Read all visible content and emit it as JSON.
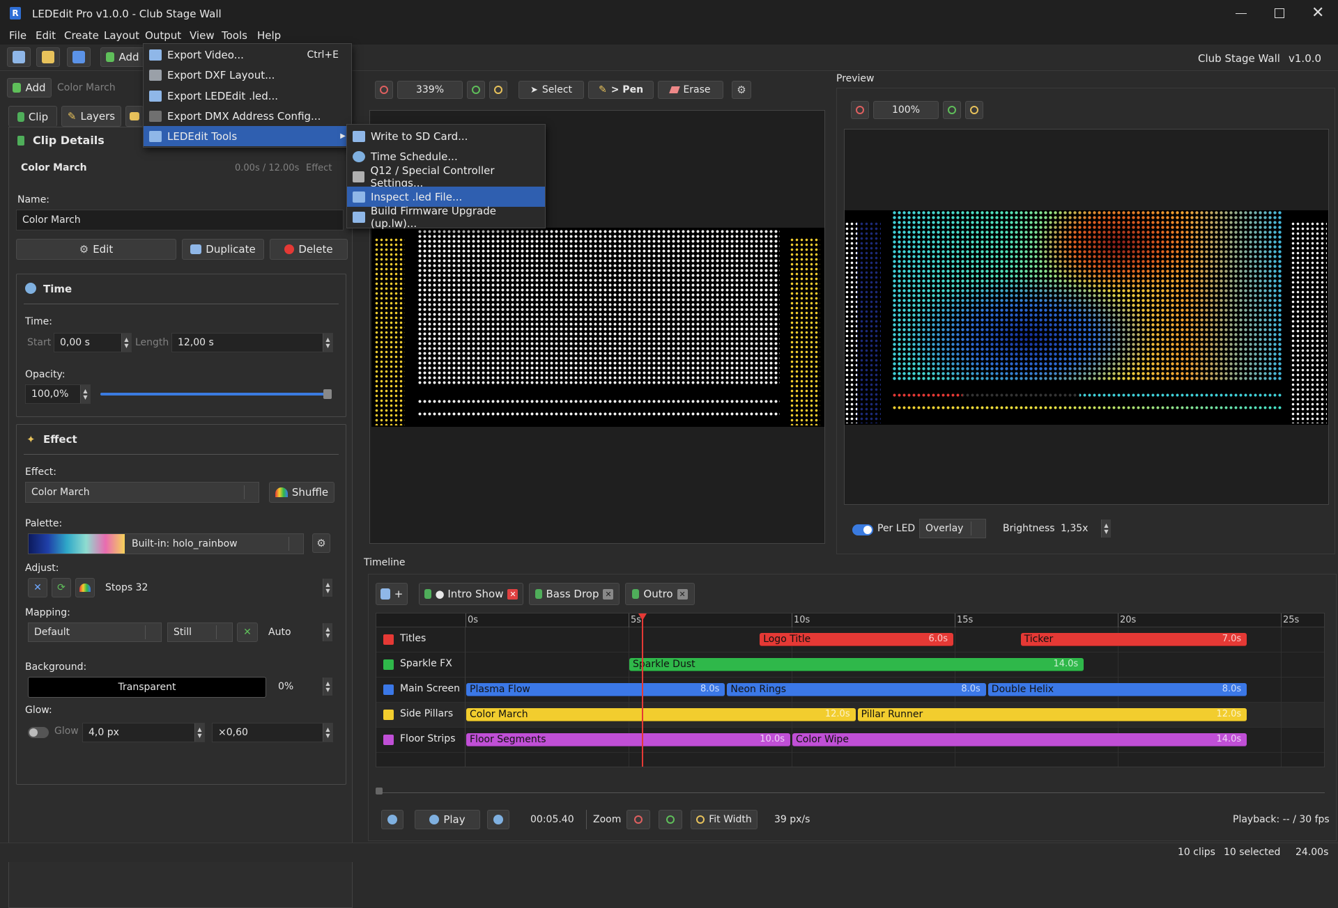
{
  "window": {
    "title": "LEDEdit Pro v1.0.0 - Club Stage Wall",
    "project_name": "Club Stage Wall",
    "version": "v1.0.0"
  },
  "menubar": [
    "File",
    "Edit",
    "Create",
    "Layout",
    "Output",
    "View",
    "Tools",
    "Help"
  ],
  "toolbar": {
    "add_label": "Add"
  },
  "output_menu": {
    "items": [
      {
        "label": "Export Video...",
        "shortcut": "Ctrl+E",
        "icon": "film-icon"
      },
      {
        "label": "Export DXF Layout...",
        "shortcut": "",
        "icon": "dxf-icon"
      },
      {
        "label": "Export LEDEdit .led...",
        "shortcut": "",
        "icon": "led-file-icon"
      },
      {
        "label": "Export DMX Address Config...",
        "shortcut": "",
        "icon": "dmx-icon"
      },
      {
        "label": "LEDEdit Tools",
        "shortcut": "",
        "icon": "tools-icon"
      }
    ]
  },
  "tools_submenu": {
    "items": [
      {
        "label": "Write to SD Card...",
        "icon": "sd-card-icon"
      },
      {
        "label": "Time Schedule...",
        "icon": "clock-icon"
      },
      {
        "label": "Q12 / Special Controller Settings...",
        "icon": "controller-icon"
      },
      {
        "label": "Inspect .led File...",
        "icon": "inspect-icon"
      },
      {
        "label": "Build Firmware Upgrade (up.lw)...",
        "icon": "firmware-icon"
      }
    ]
  },
  "left_panel": {
    "add_label": "Add",
    "add_placeholder": "Color March",
    "tabs": [
      "Clip",
      "Layers"
    ],
    "clip_details_title": "Clip Details",
    "clip_name": "Color March",
    "clip_time_range": "0.00s / 12.00s",
    "clip_type": "Effect",
    "name_label": "Name:",
    "name_value": "Color March",
    "edit_label": "Edit",
    "duplicate_label": "Duplicate",
    "delete_label": "Delete",
    "time": {
      "title": "Time",
      "time_label": "Time:",
      "start_label": "Start",
      "start_value": "0,00 s",
      "length_label": "Length",
      "length_value": "12,00 s",
      "opacity_label": "Opacity:",
      "opacity_value": "100,0%",
      "opacity_level": 1.0
    },
    "effect": {
      "title": "Effect",
      "effect_label": "Effect:",
      "effect_value": "Color March",
      "shuffle_label": "Shuffle",
      "palette_label": "Palette:",
      "palette_value": "Built-in: holo_rainbow",
      "adjust_label": "Adjust:",
      "stops_value": "Stops 32",
      "mapping_label": "Mapping:",
      "mapping_value": "Default",
      "still_value": "Still",
      "auto_value": "Auto",
      "background_label": "Background:",
      "background_value": "Transparent",
      "background_pct": "0%",
      "glow_label": "Glow:",
      "glow_toggle_label": "Glow",
      "glow_px": "4,0 px",
      "glow_mult": "×0,60"
    }
  },
  "editor": {
    "zoom": "339%",
    "select_label": "Select",
    "pen_label": "> Pen",
    "erase_label": "Erase"
  },
  "preview": {
    "title": "Preview",
    "zoom": "100%",
    "per_led_label": "Per LED",
    "overlay_value": "Overlay",
    "brightness_label": "Brightness",
    "brightness_value": "1,35x"
  },
  "timeline": {
    "title": "Timeline",
    "tabs": [
      {
        "label": "● Intro Show",
        "closable": true,
        "active": true
      },
      {
        "label": "Bass Drop",
        "closable": true,
        "active": false
      },
      {
        "label": "Outro",
        "closable": true,
        "active": false
      }
    ],
    "ruler": [
      "0s",
      "5s",
      "10s",
      "15s",
      "20s",
      "25s"
    ],
    "playhead_seconds": 5.4,
    "tracks": [
      {
        "name": "Titles",
        "color": "#e53935"
      },
      {
        "name": "Sparkle FX",
        "color": "#2fb84a"
      },
      {
        "name": "Main Screen",
        "color": "#3b78e7"
      },
      {
        "name": "Side Pillars",
        "color": "#f2cd2e"
      },
      {
        "name": "Floor Strips",
        "color": "#c04fd6"
      }
    ],
    "clips": [
      {
        "track": 0,
        "name": "Logo Title",
        "start": 9.0,
        "length": 6.0,
        "duration_label": "6.0s"
      },
      {
        "track": 0,
        "name": "Ticker",
        "start": 17.0,
        "length": 7.0,
        "duration_label": "7.0s"
      },
      {
        "track": 1,
        "name": "Sparkle Dust",
        "start": 5.0,
        "length": 14.0,
        "duration_label": "14.0s"
      },
      {
        "track": 2,
        "name": "Plasma Flow",
        "start": 0.0,
        "length": 8.0,
        "duration_label": "8.0s"
      },
      {
        "track": 2,
        "name": "Neon Rings",
        "start": 8.0,
        "length": 8.0,
        "duration_label": "8.0s"
      },
      {
        "track": 2,
        "name": "Double Helix",
        "start": 16.0,
        "length": 8.0,
        "duration_label": "8.0s"
      },
      {
        "track": 3,
        "name": "Color March",
        "start": 0.0,
        "length": 12.0,
        "duration_label": "12.0s"
      },
      {
        "track": 3,
        "name": "Pillar Runner",
        "start": 12.0,
        "length": 12.0,
        "duration_label": "12.0s"
      },
      {
        "track": 4,
        "name": "Floor Segments",
        "start": 0.0,
        "length": 10.0,
        "duration_label": "10.0s"
      },
      {
        "track": 4,
        "name": "Color Wipe",
        "start": 10.0,
        "length": 14.0,
        "duration_label": "14.0s"
      }
    ],
    "transport": {
      "play_label": "Play",
      "timecode": "00:05.40",
      "zoom_label": "Zoom",
      "fit_width_label": "Fit Width",
      "px_per_s": "39 px/s",
      "playback": "Playback: -- / 30 fps"
    }
  },
  "statusbar": {
    "clips": "10 clips",
    "selected": "10 selected",
    "time": "24.00s"
  }
}
